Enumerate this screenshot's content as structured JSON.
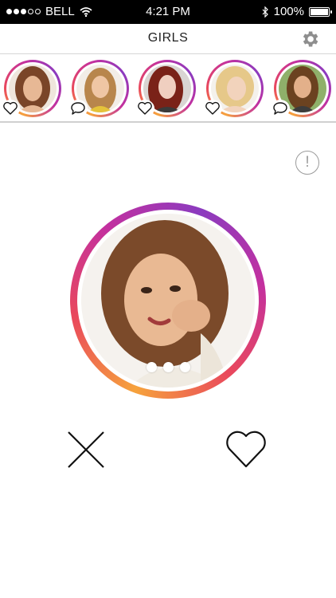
{
  "status": {
    "carrier": "BELL",
    "time": "4:21 PM",
    "battery": "100%",
    "signal_bars_filled": 3,
    "signal_bars_total": 5
  },
  "nav": {
    "title": "GIRLS",
    "settings_icon": "gear-icon"
  },
  "thumbnails": [
    {
      "badge": "heart-icon",
      "hair": "#7a4528",
      "bg": "#efe6dc",
      "skin": "#e7b895"
    },
    {
      "badge": "chat-bubble-icon",
      "hair": "#b8864c",
      "bg": "#f2ede7",
      "skin": "#efc6a4"
    },
    {
      "badge": "heart-icon",
      "hair": "#7a2218",
      "bg": "#d9d5d3",
      "skin": "#f0cfc0"
    },
    {
      "badge": "heart-icon",
      "hair": "#e6c889",
      "bg": "#f4f1ec",
      "skin": "#f2d3bc"
    },
    {
      "badge": "chat-bubble-icon",
      "hair": "#6b4220",
      "bg": "#8fb06a",
      "skin": "#e3b08a"
    }
  ],
  "main": {
    "report_label": "!",
    "hair": "#7b4a2a",
    "bg": "#f5f2ee",
    "skin": "#e9b993"
  },
  "actions": {
    "dislike_icon": "close-x-icon",
    "like_icon": "heart-icon"
  },
  "colors": {
    "ring_orange": "#f6a23c",
    "ring_pink": "#e9485c",
    "ring_purple": "#8b3bbf",
    "divider": "#d0d0d0"
  }
}
